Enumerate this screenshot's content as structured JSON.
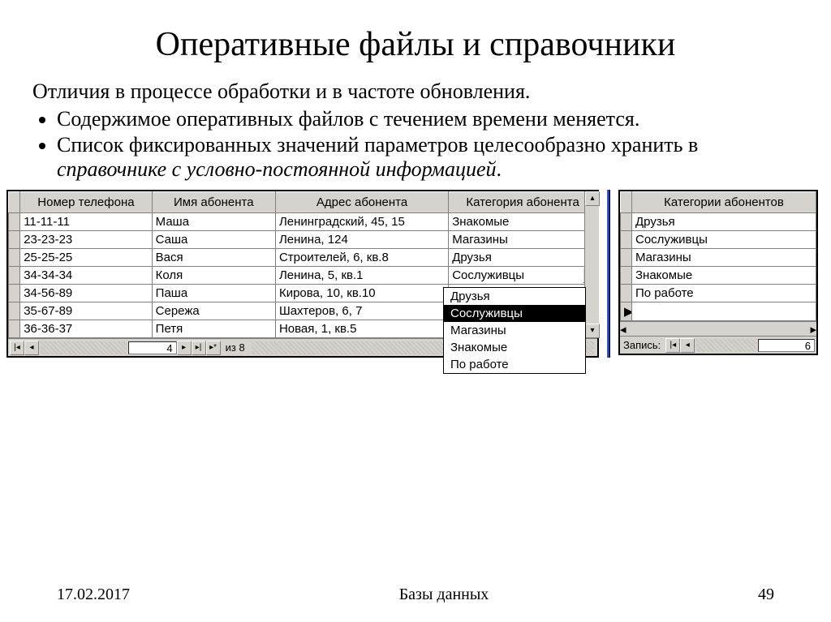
{
  "slide": {
    "title": "Оперативные файлы и справочники",
    "subtitle": "Отличия в процессе обработки и в частоте обновления.",
    "bullet1": "Содержимое оперативных файлов с течением времени меняется.",
    "bullet2_a": "Список фиксированных значений параметров целесообразно хранить в ",
    "bullet2_em": "справочнике с условно-постоянной информацией",
    "bullet2_b": "."
  },
  "leftTable": {
    "headers": {
      "c1": "Номер телефона",
      "c2": "Имя абонента",
      "c3": "Адрес абонента",
      "c4": "Категория абонента"
    },
    "rows": [
      {
        "phone": "11-11-11",
        "name": "Маша",
        "addr": "Ленинградский, 45, 15",
        "cat": "Знакомые"
      },
      {
        "phone": "23-23-23",
        "name": "Саша",
        "addr": "Ленина, 124",
        "cat": "Магазины"
      },
      {
        "phone": "25-25-25",
        "name": "Вася",
        "addr": "Строителей, 6, кв.8",
        "cat": "Друзья"
      },
      {
        "phone": "34-34-34",
        "name": "Коля",
        "addr": "Ленина, 5, кв.1",
        "cat": "Сослуживцы"
      },
      {
        "phone": "34-56-89",
        "name": "Паша",
        "addr": "Кирова, 10, кв.10",
        "cat": ""
      },
      {
        "phone": "35-67-89",
        "name": "Сережа",
        "addr": "Шахтеров, 6, 7",
        "cat": ""
      },
      {
        "phone": "36-36-37",
        "name": "Петя",
        "addr": "Новая, 1, кв.5",
        "cat": ""
      }
    ],
    "nav": {
      "current": "4",
      "of_label": "из",
      "total": "8"
    }
  },
  "dropdown": {
    "items": [
      "Друзья",
      "Сослуживцы",
      "Магазины",
      "Знакомые",
      "По работе"
    ],
    "selected": "Сослуживцы"
  },
  "rightTable": {
    "header": "Категории абонентов",
    "rows": [
      "Друзья",
      "Сослуживцы",
      "Магазины",
      "Знакомые",
      "По работе"
    ],
    "nav": {
      "label": "Запись:",
      "current": "6"
    }
  },
  "footer": {
    "date": "17.02.2017",
    "center": "Базы данных",
    "page": "49"
  }
}
